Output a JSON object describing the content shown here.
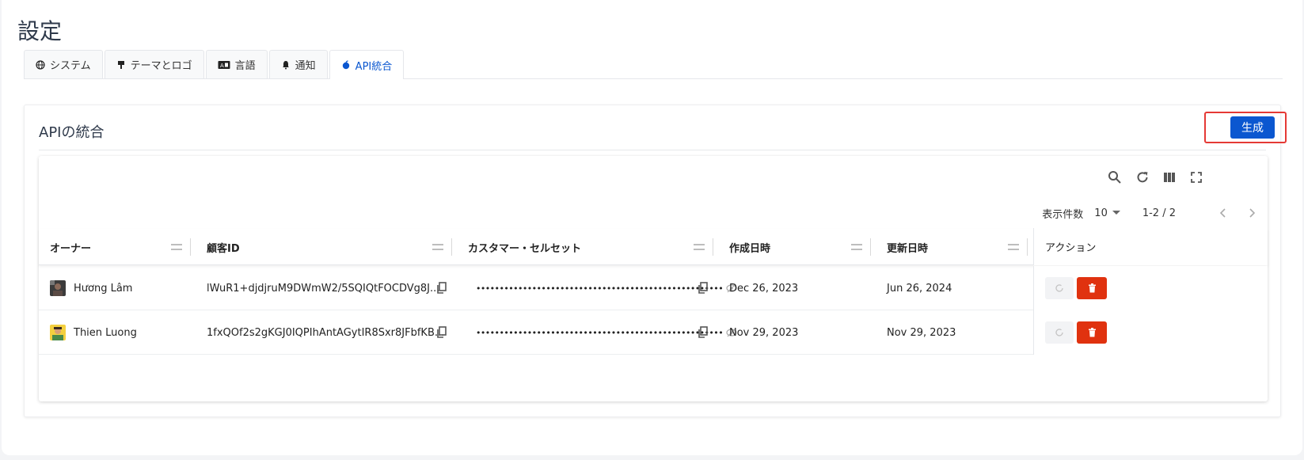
{
  "page": {
    "title": "設定"
  },
  "tabs": [
    {
      "label": "システム",
      "icon": "globe-icon"
    },
    {
      "label": "テーマとロゴ",
      "icon": "paint-brush-icon"
    },
    {
      "label": "言語",
      "icon": "language-icon"
    },
    {
      "label": "通知",
      "icon": "bell-icon"
    },
    {
      "label": "API統合",
      "icon": "apple-icon",
      "active": true
    }
  ],
  "api": {
    "title": "APIの統合",
    "generate_label": "生成"
  },
  "toolbar": {
    "icons": [
      "search-icon",
      "refresh-icon",
      "columns-icon",
      "fullscreen-icon"
    ]
  },
  "pagination": {
    "label": "表示件数",
    "page_size": "10",
    "range": "1-2 / 2"
  },
  "table": {
    "columns": [
      "オーナー",
      "顧客ID",
      "カスタマー・セルセット",
      "作成日時",
      "更新日時"
    ],
    "action_header": "アクション",
    "rows": [
      {
        "owner": "Hương Lâm",
        "client_id": "lWuR1+djdjruM9DWmW2/5SQIQtFOCDVg8J...",
        "secret": "•••••••••••••••••••••••••••••••••••••••••••••••••••••",
        "created": "Dec 26, 2023",
        "updated": "Jun 26, 2024"
      },
      {
        "owner": "Thien Luong",
        "client_id": "1fxQOf2s2gKGJ0IQPIhAntAGytIR8Sxr8JFbfKB...",
        "secret": "•••••••••••••••••••••••••••••••••••••••••••••••••••••",
        "created": "Nov 29, 2023",
        "updated": "Nov 29, 2023"
      }
    ]
  },
  "colors": {
    "accent": "#0b57d0",
    "danger": "#e0320f",
    "highlight": "#e53935"
  }
}
